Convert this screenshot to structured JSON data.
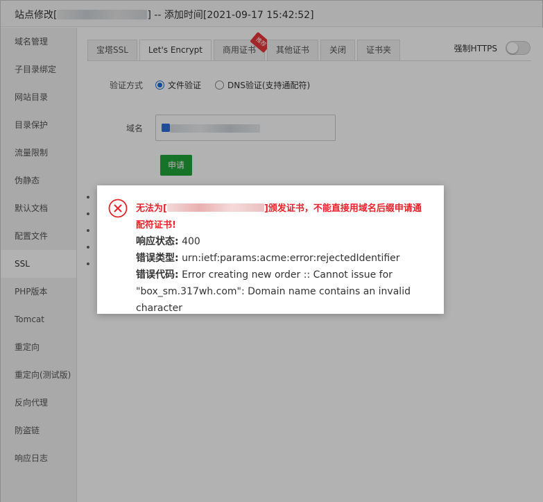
{
  "window": {
    "title_prefix": "站点修改[",
    "title_suffix": "] -- 添加时间[2021-09-17 15:42:52]"
  },
  "sidebar": {
    "items": [
      {
        "label": "域名管理"
      },
      {
        "label": "子目录绑定"
      },
      {
        "label": "网站目录"
      },
      {
        "label": "目录保护"
      },
      {
        "label": "流量限制"
      },
      {
        "label": "伪静态"
      },
      {
        "label": "默认文档"
      },
      {
        "label": "配置文件"
      },
      {
        "label": "SSL"
      },
      {
        "label": "PHP版本"
      },
      {
        "label": "Tomcat"
      },
      {
        "label": "重定向"
      },
      {
        "label": "重定向(测试版)"
      },
      {
        "label": "反向代理"
      },
      {
        "label": "防盗链"
      },
      {
        "label": "响应日志"
      }
    ],
    "active": "SSL"
  },
  "tabs": [
    {
      "label": "宝塔SSL"
    },
    {
      "label": "Let's Encrypt"
    },
    {
      "label": "商用证书",
      "badge": "推荐"
    },
    {
      "label": "其他证书"
    },
    {
      "label": "关闭"
    },
    {
      "label": "证书夹"
    }
  ],
  "active_tab": "Let's Encrypt",
  "force_https": {
    "label": "强制HTTPS",
    "enabled": false
  },
  "form": {
    "verify_label": "验证方式",
    "verify_options": [
      {
        "label": "文件验证",
        "checked": true
      },
      {
        "label": "DNS验证(支持通配符)",
        "checked": false
      }
    ],
    "domain_label": "域名",
    "apply_button": "申请"
  },
  "dialog": {
    "title_prefix": "无法为[",
    "title_suffix": "]颁发证书，不能直接用域名后缀申请通配符证书!",
    "status_key": "响应状态:",
    "status_value": "400",
    "type_key": "错误类型:",
    "type_value": "urn:ietf:params:acme:error:rejectedIdentifier",
    "code_key": "错误代码:",
    "code_value": "Error creating new order :: Cannot issue for \"box_sm.317wh.com\": Domain name contains an invalid character"
  },
  "colors": {
    "accent_green": "#20a53a",
    "error_red": "#e8212a",
    "radio_blue": "#1e6fd9"
  }
}
